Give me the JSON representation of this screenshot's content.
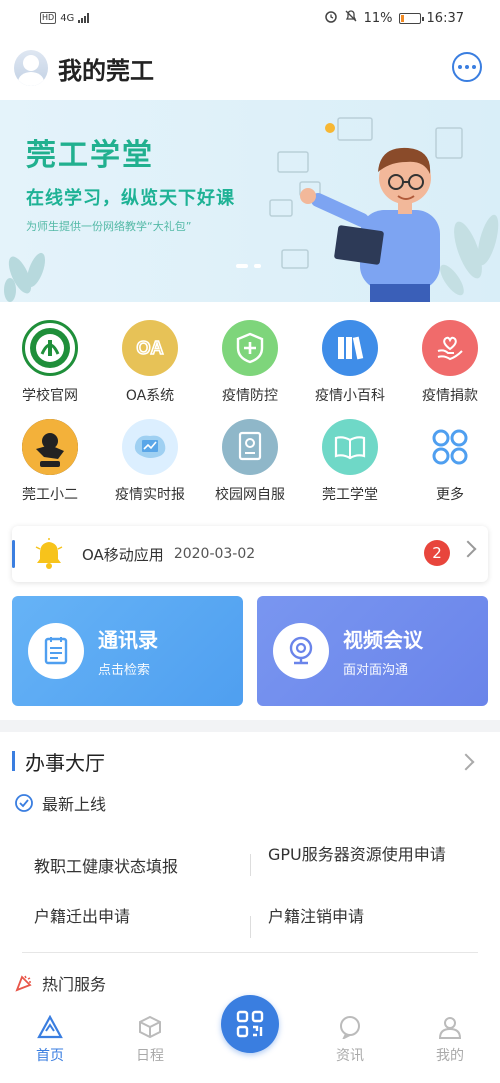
{
  "status_bar": {
    "network": "HD",
    "signal": "4G",
    "battery": "11%",
    "time": "16:37"
  },
  "header": {
    "title": "我的莞工"
  },
  "banner": {
    "title": "莞工学堂",
    "subtitle": "在线学习，纵览天下好课",
    "desc": "为师生提供一份网络教学“大礼包”"
  },
  "apps": [
    {
      "label": "学校官网",
      "icon": "school-logo-icon",
      "color": "#1f8f3a"
    },
    {
      "label": "OA系统",
      "icon": "oa-icon",
      "color": "#e7c257"
    },
    {
      "label": "疫情防控",
      "icon": "shield-plus-icon",
      "color": "#7ed57b"
    },
    {
      "label": "疫情小百科",
      "icon": "books-icon",
      "color": "#3f8de8"
    },
    {
      "label": "疫情捐款",
      "icon": "donation-heart-icon",
      "color": "#f06b6b"
    },
    {
      "label": "莞工小二",
      "icon": "mascot-icon",
      "color": "#f3b13a"
    },
    {
      "label": "疫情实时报",
      "icon": "map-chart-icon",
      "color": "#9fd0f2"
    },
    {
      "label": "校园网自服",
      "icon": "network-service-icon",
      "color": "#8fb7c9"
    },
    {
      "label": "莞工学堂",
      "icon": "open-book-icon",
      "color": "#6fd8c7"
    },
    {
      "label": "更多",
      "icon": "more-grid-icon",
      "color": "#4f9ff0"
    }
  ],
  "notice": {
    "text": "OA移动应用",
    "date": "2020-03-02",
    "badge": "2"
  },
  "cards": [
    {
      "title": "通讯录",
      "subtitle": "点击检索",
      "icon": "contacts-icon"
    },
    {
      "title": "视频会议",
      "subtitle": "面对面沟通",
      "icon": "webcam-icon"
    }
  ],
  "hall": {
    "title": "办事大厅",
    "latest_title": "最新上线",
    "items": [
      "教职工健康状态填报",
      "GPU服务器资源使用申请",
      "户籍迁出申请",
      "户籍注销申请"
    ],
    "hot_title": "热门服务"
  },
  "tabbar": {
    "items": [
      {
        "label": "首页",
        "icon": "home-icon"
      },
      {
        "label": "日程",
        "icon": "schedule-icon"
      },
      {
        "label": "资讯",
        "icon": "news-icon"
      },
      {
        "label": "我的",
        "icon": "profile-icon"
      }
    ],
    "center_icon": "qr-scan-icon"
  },
  "colors": {
    "accent": "#3a7ee0",
    "banner_green": "#21b08f",
    "badge_red": "#e8453c"
  }
}
